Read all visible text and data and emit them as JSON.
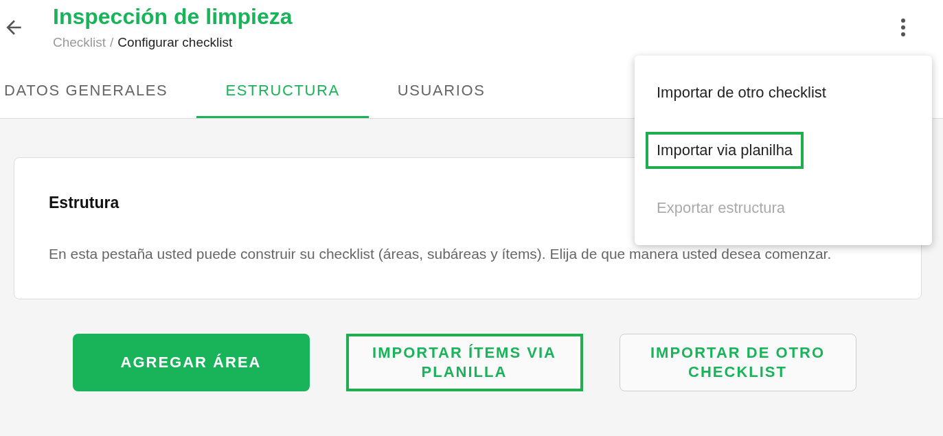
{
  "header": {
    "title": "Inspección de limpieza",
    "breadcrumb": [
      {
        "label": "Checklist",
        "current": false
      },
      {
        "label": "Configurar checklist",
        "current": true
      }
    ],
    "separator": "/"
  },
  "tabs": [
    {
      "label": "DATOS GENERALES",
      "selected": false
    },
    {
      "label": "ESTRUCTURA",
      "selected": true
    },
    {
      "label": "USUARIOS",
      "selected": false
    }
  ],
  "card": {
    "title": "Estrutura",
    "text": "En esta pestaña usted puede construir su checklist (áreas, subáreas y ítems). Elija de que manera usted desea comenzar."
  },
  "buttons": [
    {
      "label": "AGREGAR ÁREA",
      "kind": "filled",
      "highlighted": false
    },
    {
      "label": "IMPORTAR ÍTEMS VIA PLANILLA",
      "kind": "outlined",
      "highlighted": true
    },
    {
      "label": "IMPORTAR DE OTRO CHECKLIST",
      "kind": "outlined",
      "highlighted": false
    }
  ],
  "menu": [
    {
      "label": "Importar de otro checklist",
      "highlighted": false,
      "disabled": false
    },
    {
      "label": "Importar via planilha",
      "highlighted": true,
      "disabled": false
    },
    {
      "label": "Exportar estructura",
      "highlighted": false,
      "disabled": true
    }
  ]
}
